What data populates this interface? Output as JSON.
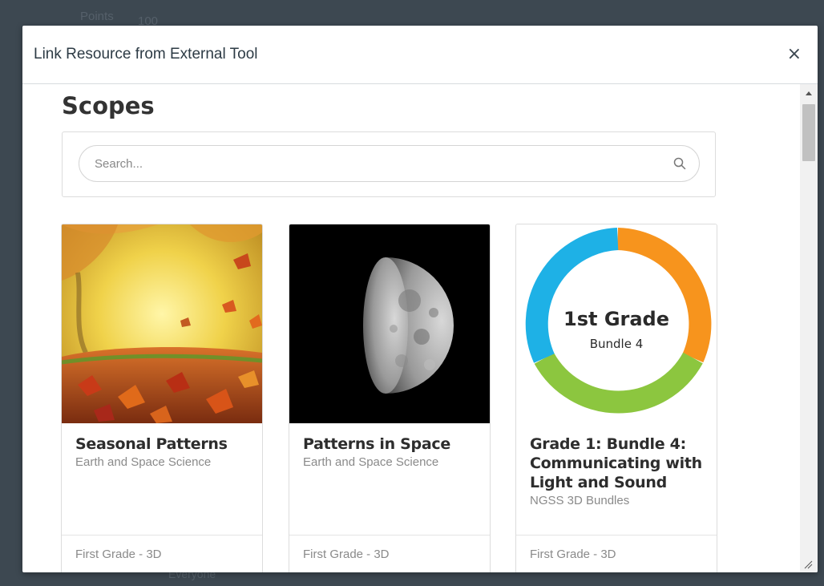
{
  "background": {
    "points_label": "Points",
    "points_value": "100",
    "bottom_text": "Everyone"
  },
  "modal": {
    "title": "Link Resource from External Tool",
    "close_glyph": "×"
  },
  "body": {
    "heading": "Scopes",
    "search": {
      "placeholder": "Search...",
      "icon": "search-icon"
    }
  },
  "cards": [
    {
      "title": "Seasonal Patterns",
      "subtitle": "Earth and Space Science",
      "footer": "First Grade - 3D",
      "image": "autumn-leaves"
    },
    {
      "title": "Patterns in Space",
      "subtitle": "Earth and Space Science",
      "footer": "First Grade - 3D",
      "image": "half-moon"
    },
    {
      "title": "Grade 1: Bundle 4: Communicating with Light and Sound",
      "subtitle": "NGSS 3D Bundles",
      "footer": "First Grade - 3D",
      "image": "grade-ring",
      "image_text": {
        "line1": "1st Grade",
        "line2": "Bundle 4"
      }
    }
  ],
  "colors": {
    "ring_blue": "#1eb1e6",
    "ring_orange": "#f7941d",
    "ring_green": "#8cc63f"
  }
}
